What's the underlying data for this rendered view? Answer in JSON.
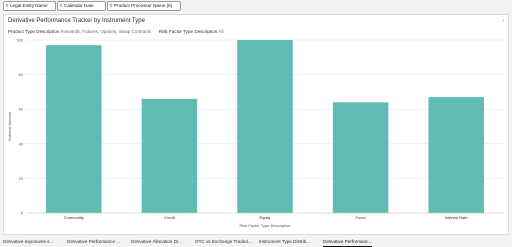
{
  "filters": [
    {
      "label": "Legal Entity Name",
      "icon": "filter-icon"
    },
    {
      "label": "Calendar Date",
      "icon": "filter-icon"
    },
    {
      "label": "Product Processor Name (5)",
      "icon": "filter-icon"
    }
  ],
  "panel": {
    "title": "Derivative Performance Tracker by Instrument Type",
    "subtitle": [
      {
        "key": "Product Type Description",
        "value": "Forwards, Futures, Options, Swap Contracts"
      },
      {
        "key": "Risk Factor Type Description",
        "value": "All"
      }
    ],
    "collapse_icon": "chevron-icon"
  },
  "chart_data": {
    "type": "bar",
    "categories": [
      "Commodity",
      "Credit",
      "Equity",
      "Forex",
      "Interest Rate"
    ],
    "values": [
      97,
      66,
      100,
      64,
      67
    ],
    "xlabel": "Risk Factor Type Description",
    "ylabel": "Notional Amount",
    "ylim": [
      0,
      100
    ],
    "yticks": [
      "0",
      "20",
      "40",
      "60",
      "80",
      "100"
    ],
    "grid": true,
    "bar_color": "#5fbcb4"
  },
  "tabs": [
    {
      "label": "Derivative exposures s...",
      "active": false
    },
    {
      "label": "Derivative Performance ...",
      "active": false
    },
    {
      "label": "Derivative Allocation Dr...",
      "active": false
    },
    {
      "label": "OTC vs Exchange Traded...",
      "active": false
    },
    {
      "label": "Instrument Type Distrib...",
      "active": false
    },
    {
      "label": "Derivative Performanc...",
      "active": true
    }
  ]
}
